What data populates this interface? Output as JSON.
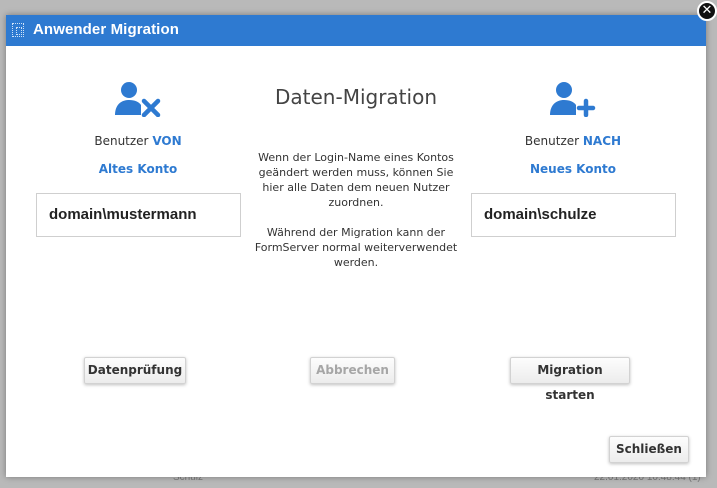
{
  "background": {
    "footer_left": "Schulz",
    "footer_right": "22.01.2020 10:48:44 (1)"
  },
  "dialog": {
    "title": "Anwender Migration",
    "close_symbol": "✕",
    "heading": "Daten-Migration",
    "description_1": "Wenn der Login-Name eines Kontos geändert werden muss, können Sie hier alle Daten dem neuen Nutzer zuordnen.",
    "description_2": "Während der Migration kann der FormServer normal weiterverwendet werden.",
    "from": {
      "caption_prefix": "Benutzer ",
      "caption_highlight": "VON",
      "subtitle": "Altes Konto",
      "value": "domain\\mustermann",
      "icon": "user-remove-icon"
    },
    "to": {
      "caption_prefix": "Benutzer ",
      "caption_highlight": "NACH",
      "subtitle": "Neues Konto",
      "value": "domain\\schulze",
      "icon": "user-add-icon"
    },
    "buttons": {
      "check": "Datenprüfung",
      "cancel": "Abbrechen",
      "start": "Migration starten",
      "close": "Schließen"
    }
  },
  "colors": {
    "accent": "#2e7ad1",
    "titlebar": "#2e7ad1",
    "disabled_text": "#a6a6a6"
  }
}
